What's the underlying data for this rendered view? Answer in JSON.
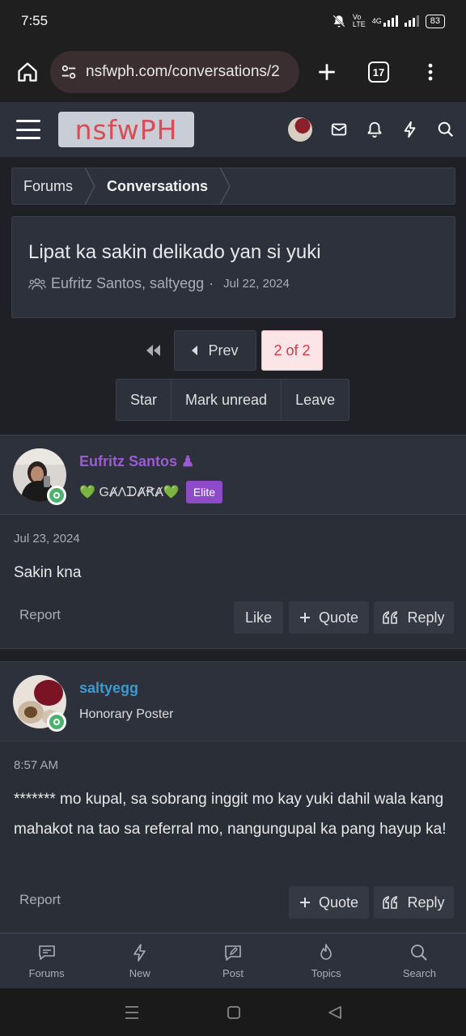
{
  "status_bar": {
    "time": "7:55",
    "network": "4G",
    "battery": "83"
  },
  "browser": {
    "url": "nsfwph.com/conversations/2",
    "tab_count": "17"
  },
  "site": {
    "logo_text": "nsfwPH"
  },
  "breadcrumb": {
    "items": [
      "Forums",
      "Conversations"
    ]
  },
  "conversation": {
    "title": "Lipat ka sakin delikado yan si yuki",
    "participants": "Eufritz Santos, saltyegg",
    "separator": "·",
    "date": "Jul 22, 2024"
  },
  "pagination": {
    "prev_label": "Prev",
    "current": "2 of 2"
  },
  "actions": [
    "Star",
    "Mark unread",
    "Leave"
  ],
  "messages": [
    {
      "username": "Eufritz Santos",
      "user_color": "#9b5bd4",
      "user_title": "💚 ԌȺɅᗪȺꞦȺ💚",
      "badge": "Elite",
      "date": "Jul 23, 2024",
      "body": "Sakin kna",
      "report": "Report",
      "buttons": {
        "like": "Like",
        "quote": "Quote",
        "reply": "Reply"
      }
    },
    {
      "username": "saltyegg",
      "user_color": "#3d9ad1",
      "user_title": "Honorary Poster",
      "date": "8:57 AM",
      "body": "******* mo kupal, sa sobrang inggit mo kay yuki dahil wala kang mahakot na tao sa referral mo, nangungupal ka pang hayup ka!",
      "report": "Report",
      "buttons": {
        "quote": "Quote",
        "reply": "Reply"
      }
    }
  ],
  "bottom_nav": [
    "Forums",
    "New",
    "Post",
    "Topics",
    "Search"
  ]
}
